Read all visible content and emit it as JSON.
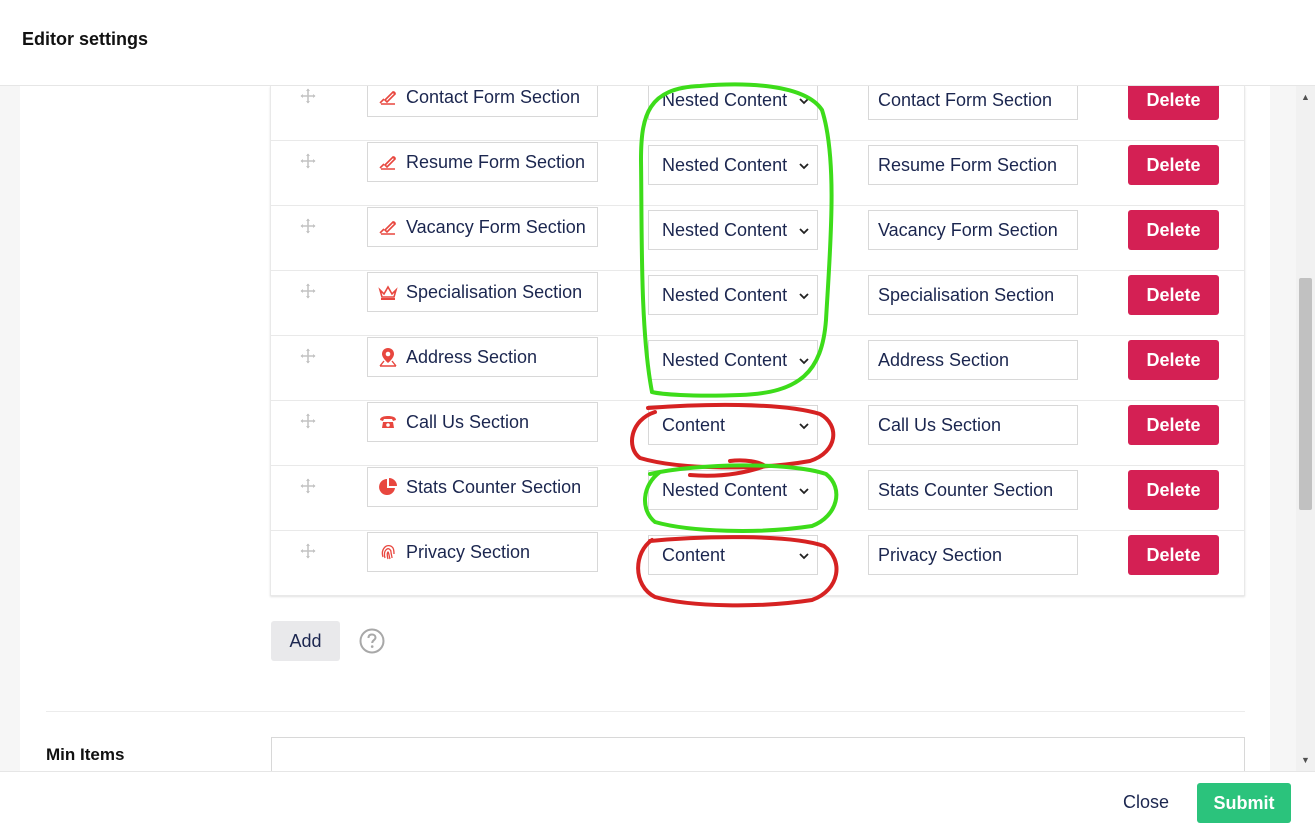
{
  "header": {
    "title": "Editor settings"
  },
  "list": {
    "rows": [
      {
        "icon": "edit-signature-icon",
        "name": "Contact Form Section",
        "type": "Nested Content",
        "alias": "Contact Form Section",
        "delete": "Delete"
      },
      {
        "icon": "edit-signature-icon",
        "name": "Resume Form Section",
        "type": "Nested Content",
        "alias": "Resume Form Section",
        "delete": "Delete"
      },
      {
        "icon": "edit-signature-icon",
        "name": "Vacancy Form Section",
        "type": "Nested Content",
        "alias": "Vacancy Form Section",
        "delete": "Delete"
      },
      {
        "icon": "crown-icon",
        "name": "Specialisation Section",
        "type": "Nested Content",
        "alias": "Specialisation Section",
        "delete": "Delete"
      },
      {
        "icon": "map-pin-icon",
        "name": "Address Section",
        "type": "Nested Content",
        "alias": "Address Section",
        "delete": "Delete"
      },
      {
        "icon": "telephone-icon",
        "name": "Call Us Section",
        "type": "Content",
        "alias": "Call Us Section",
        "delete": "Delete"
      },
      {
        "icon": "pie-chart-icon",
        "name": "Stats Counter Section",
        "type": "Nested Content",
        "alias": "Stats Counter Section",
        "delete": "Delete"
      },
      {
        "icon": "fingerprint-icon",
        "name": "Privacy Section",
        "type": "Content",
        "alias": "Privacy Section",
        "delete": "Delete"
      }
    ]
  },
  "add_label": "Add",
  "min_items": {
    "label": "Min Items",
    "value": ""
  },
  "footer": {
    "close_label": "Close",
    "submit_label": "Submit"
  },
  "colors": {
    "icon": "#e8473f",
    "delete": "#d42054",
    "submit": "#2bc37c",
    "annotation_green": "#3ddc1a",
    "annotation_red": "#d62222",
    "text": "#1b264f"
  }
}
